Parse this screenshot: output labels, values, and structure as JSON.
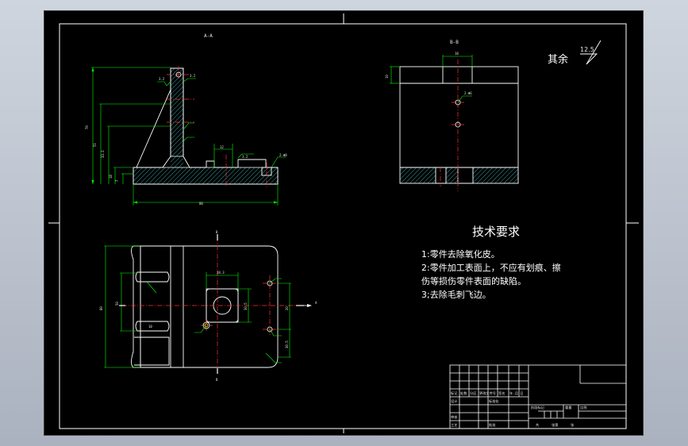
{
  "views": {
    "section_a": "A-A",
    "section_b": "B-B",
    "arrow_a": "A",
    "arrow_b": "B"
  },
  "surface_finish": {
    "label": "其余",
    "value": "12.5"
  },
  "tech_requirements": {
    "title": "技术要求",
    "lines": [
      "1:零件去除氧化皮。",
      "2:零件加工表面上，不应有划痕、擦",
      "伤等损伤零件表面的缺陷。",
      "3;去除毛刺飞边。"
    ]
  },
  "title_block": {
    "row_labels": [
      "标记",
      "处数",
      "分区",
      "更改文件号",
      "签名",
      "年.月.日"
    ],
    "left_labels": [
      "设计",
      "审核",
      "工艺"
    ],
    "std_label": "标准化",
    "approve_label": "批准",
    "stage_labels": [
      "阶段标记",
      "重量",
      "比例"
    ],
    "sheet_labels": [
      "共",
      "张第",
      "张"
    ]
  },
  "colors": {
    "sheet_bg": "#000000",
    "part_outline": "#ffffff",
    "dimension": "#00ff00",
    "centerline": "#ff3030",
    "hatch": "#3aa0a0",
    "text": "#ffffff"
  }
}
